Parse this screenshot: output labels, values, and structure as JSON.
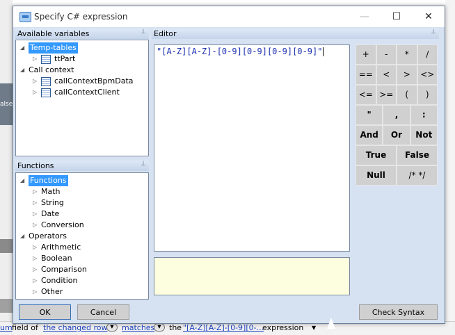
{
  "background": {
    "left_label": "alse",
    "bottom_bar": {
      "part1": "um",
      "part2": "field of",
      "link1": "the changed row",
      "link2": "matches",
      "part3": "the",
      "link3": "\"[A-Z][A-Z]-[0-9][0-...",
      "part4": "expression"
    }
  },
  "dialog": {
    "title": "Specify C# expression",
    "window_buttons": {
      "minimize": "—",
      "maximize": "☐",
      "close": "✕"
    },
    "variables_panel": {
      "header": "Available variables",
      "items": [
        {
          "label": "Temp-tables",
          "level": 0,
          "expander": "◢",
          "selected": true
        },
        {
          "label": "ttPart",
          "level": 1,
          "expander": "▷",
          "icon": "table-icon"
        },
        {
          "label": "Call context",
          "level": 0,
          "expander": "◢"
        },
        {
          "label": "callContextBpmData",
          "level": 1,
          "expander": "▷",
          "icon": "table-icon"
        },
        {
          "label": "callContextClient",
          "level": 1,
          "expander": "▷",
          "icon": "table-icon"
        }
      ]
    },
    "functions_panel": {
      "header": "Functions",
      "items": [
        {
          "label": "Functions",
          "level": 0,
          "expander": "◢",
          "selected": true
        },
        {
          "label": "Math",
          "level": 1,
          "expander": "▷"
        },
        {
          "label": "String",
          "level": 1,
          "expander": "▷"
        },
        {
          "label": "Date",
          "level": 1,
          "expander": "▷"
        },
        {
          "label": "Conversion",
          "level": 1,
          "expander": "▷"
        },
        {
          "label": "Operators",
          "level": 0,
          "expander": "◢"
        },
        {
          "label": "Arithmetic",
          "level": 1,
          "expander": "▷"
        },
        {
          "label": "Boolean",
          "level": 1,
          "expander": "▷"
        },
        {
          "label": "Comparison",
          "level": 1,
          "expander": "▷"
        },
        {
          "label": "Condition",
          "level": 1,
          "expander": "▷"
        },
        {
          "label": "Other",
          "level": 1,
          "expander": "▷"
        }
      ]
    },
    "editor_panel": {
      "header": "Editor",
      "expression": "\"[A-Z][A-Z]-[0-9][0-9][0-9][0-9]\""
    },
    "operators": [
      [
        "+",
        "-",
        "*",
        "/"
      ],
      [
        "==",
        "<",
        ">",
        "<>"
      ],
      [
        "<=",
        ">=",
        "(",
        ")"
      ],
      [
        "\"",
        ",",
        ":"
      ],
      [
        "And",
        "Or",
        "Not"
      ],
      [
        "True",
        "False"
      ],
      [
        "Null",
        "/* */"
      ]
    ],
    "buttons": {
      "ok": "OK",
      "cancel": "Cancel",
      "check_syntax": "Check Syntax"
    }
  }
}
